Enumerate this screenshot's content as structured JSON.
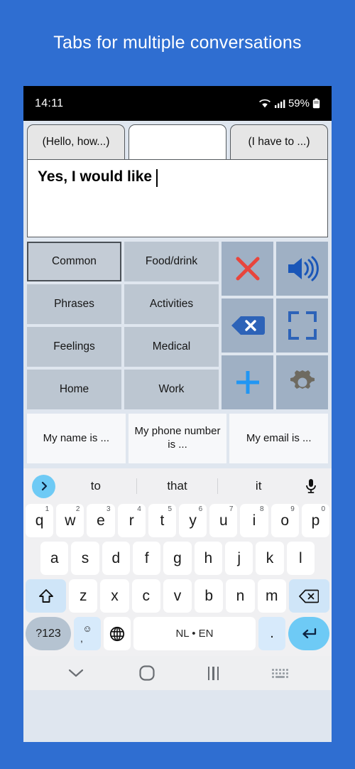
{
  "page": {
    "title": "Tabs for multiple conversations",
    "background_color": "#2f6ed1",
    "title_color": "#ffffff"
  },
  "statusbar": {
    "time": "14:11",
    "battery": "59%",
    "icons": [
      "wifi-icon",
      "cellular-signal-icon",
      "battery-icon"
    ]
  },
  "tabs": [
    {
      "label": "(Hello, how...)",
      "active": false
    },
    {
      "label": "",
      "active": true
    },
    {
      "label": "(I have to ...)",
      "active": false
    }
  ],
  "compose": {
    "text": "Yes, I would like ",
    "has_caret": true
  },
  "categories": [
    {
      "label": "Common",
      "selected": true
    },
    {
      "label": "Food/drink",
      "selected": false
    },
    {
      "label": "Phrases",
      "selected": false
    },
    {
      "label": "Activities",
      "selected": false
    },
    {
      "label": "Feelings",
      "selected": false
    },
    {
      "label": "Medical",
      "selected": false
    },
    {
      "label": "Home",
      "selected": false
    },
    {
      "label": "Work",
      "selected": false
    }
  ],
  "action_icons": [
    {
      "name": "clear-x-icon",
      "color": "#e8453c"
    },
    {
      "name": "speaker-icon",
      "color": "#1a56b8"
    },
    {
      "name": "backspace-icon",
      "color": "#2d63b8"
    },
    {
      "name": "fullscreen-icon",
      "color": "#2d63b8"
    },
    {
      "name": "add-plus-icon",
      "color": "#2196f3"
    },
    {
      "name": "settings-gear-icon",
      "color": "#6e6a60"
    }
  ],
  "phrases": [
    {
      "label": "My name is ..."
    },
    {
      "label": "My phone number is ..."
    },
    {
      "label": "My email is ..."
    }
  ],
  "keyboard": {
    "suggestions": [
      "to",
      "that",
      "it"
    ],
    "expand_icon": "chevron-right-icon",
    "mic_icon": "microphone-icon",
    "row1": [
      {
        "key": "q",
        "num": "1"
      },
      {
        "key": "w",
        "num": "2"
      },
      {
        "key": "e",
        "num": "3"
      },
      {
        "key": "r",
        "num": "4"
      },
      {
        "key": "t",
        "num": "5"
      },
      {
        "key": "y",
        "num": "6"
      },
      {
        "key": "u",
        "num": "7"
      },
      {
        "key": "i",
        "num": "8"
      },
      {
        "key": "o",
        "num": "9"
      },
      {
        "key": "p",
        "num": "0"
      }
    ],
    "row2": [
      "a",
      "s",
      "d",
      "f",
      "g",
      "h",
      "j",
      "k",
      "l"
    ],
    "row3": [
      "z",
      "x",
      "c",
      "v",
      "b",
      "n",
      "m"
    ],
    "shift_label": "shift-icon",
    "backspace_label": "backspace-icon",
    "symbols_label": "?123",
    "emoji_top": "☺",
    "emoji_bottom": ",",
    "globe_label": "globe-icon",
    "space_label": "NL • EN",
    "period_label": ".",
    "enter_label": "enter-icon"
  },
  "navbar": {
    "back": "chevron-down-icon",
    "home": "home-circle-icon",
    "recents": "recents-bars-icon",
    "dismiss_keyboard": "keyboard-dots-icon"
  }
}
